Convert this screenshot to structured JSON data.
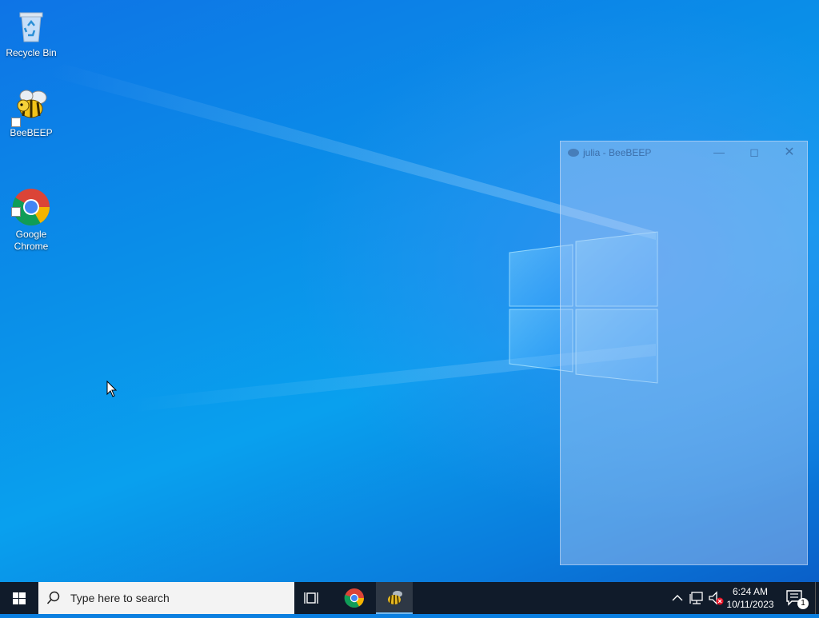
{
  "desktop": {
    "icons": [
      {
        "label": "Recycle Bin"
      },
      {
        "label": "BeeBEEP"
      },
      {
        "label": "Google\nChrome"
      }
    ]
  },
  "window": {
    "title": "julia - BeeBEEP",
    "minimize_icon": "minimize-icon",
    "maximize_icon": "maximize-icon",
    "close_icon": "close-icon"
  },
  "taskbar": {
    "search_placeholder": "Type here to search",
    "clock": {
      "time": "6:24 AM",
      "date": "10/11/2023"
    },
    "notification_count": "1",
    "apps": [
      "Google Chrome",
      "BeeBEEP"
    ]
  },
  "colors": {
    "taskbar": "#101b2a",
    "wallpaper_top": "#0e74e6",
    "wallpaper_bottom": "#0a5fc8"
  }
}
